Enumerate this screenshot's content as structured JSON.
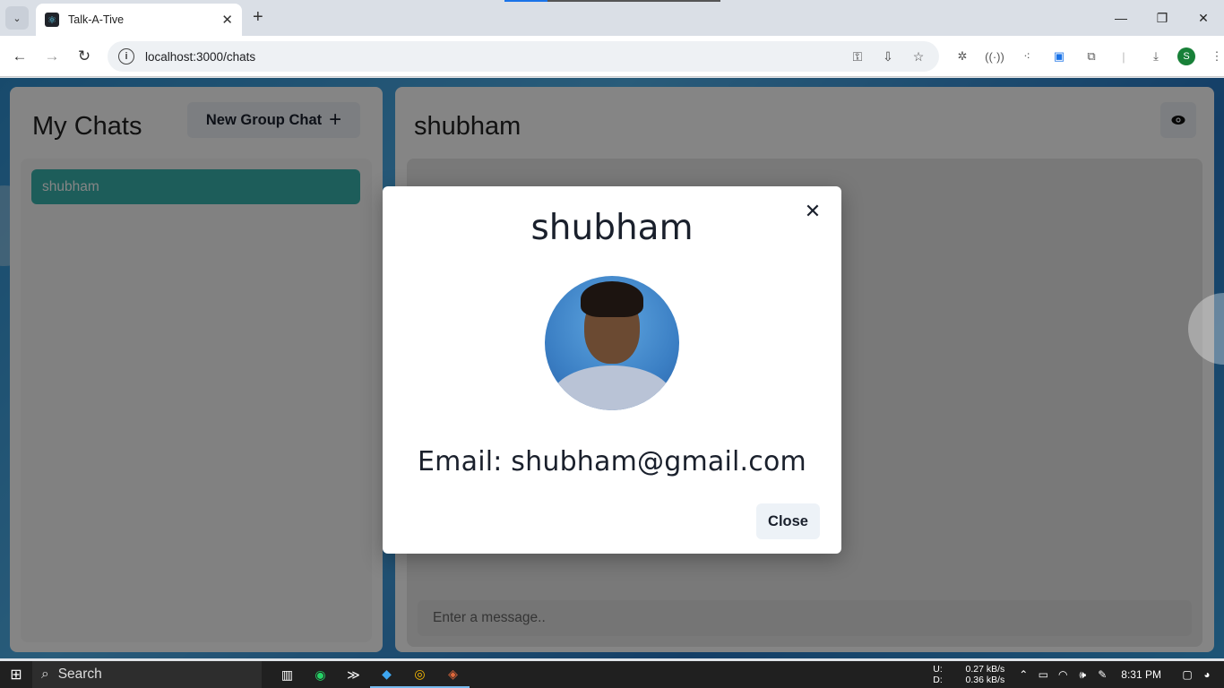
{
  "browser": {
    "tab_title": "Talk-A-Tive",
    "tab_close": "✕",
    "new_tab": "+",
    "tab_menu": "⌄",
    "url": "localhost:3000/chats",
    "profile_initial": "S",
    "window_controls": {
      "minimize": "—",
      "restore": "❐",
      "close": "✕"
    }
  },
  "sidebar": {
    "title": "My Chats",
    "new_group_label": "New Group Chat",
    "new_group_icon": "+",
    "chats": [
      {
        "name": "shubham",
        "selected": true
      }
    ]
  },
  "chat": {
    "title": "shubham",
    "message_placeholder": "Enter a message.."
  },
  "profile_modal": {
    "title": "shubham",
    "email_text": "Email: shubham@gmail.com",
    "close_label": "Close",
    "close_icon": "✕"
  },
  "taskbar": {
    "search_label": "Search",
    "net": {
      "upload_label": "U:",
      "upload_value": "0.27 kB/s",
      "download_label": "D:",
      "download_value": "0.36 kB/s"
    },
    "time": "8:31 PM"
  },
  "colors": {
    "accent": "#38b2ac",
    "modal_bg": "#ffffff",
    "button_bg": "#edf2f7",
    "page_bg": "#3a9ad9"
  }
}
